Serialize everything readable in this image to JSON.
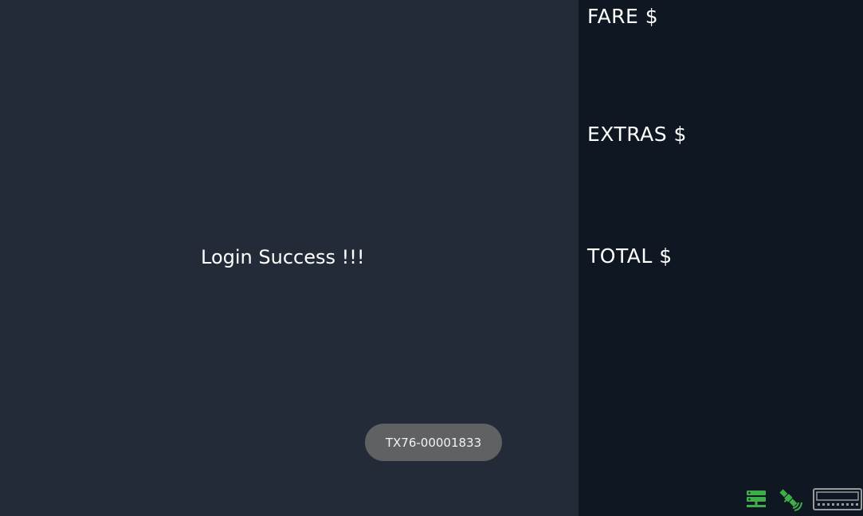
{
  "main": {
    "status_message": "Login Success !!!",
    "toast_text": "TX76-00001833"
  },
  "fare_panel": {
    "fare_label": "FARE $",
    "extras_label": "EXTRAS $",
    "total_label": "TOTAL $"
  },
  "status_bar": {
    "icons": [
      "server-icon",
      "satellite-icon",
      "meter-device-icon"
    ],
    "active_color": "#3fae49",
    "inactive_color": "#9a9a9a"
  },
  "colors": {
    "main_background": "#232b38",
    "fare_panel_background": "#0f1822",
    "toast_background": "#606163",
    "text": "#ffffff"
  }
}
